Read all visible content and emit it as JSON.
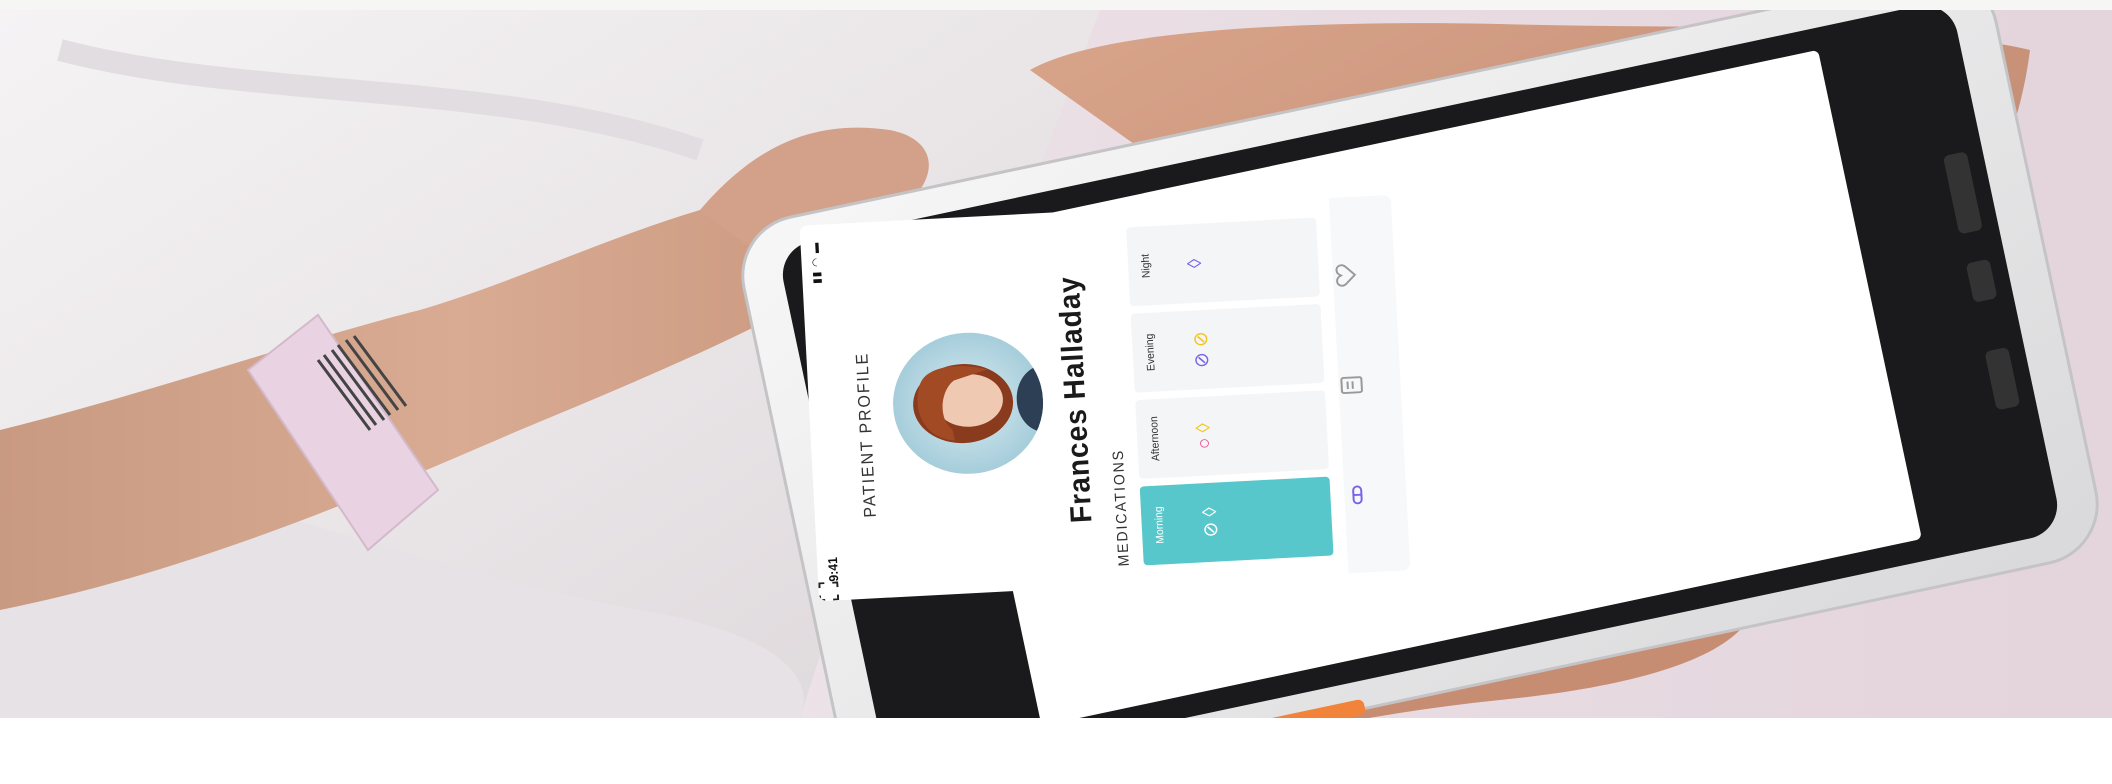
{
  "app": {
    "status_time": "9:41",
    "title": "PATIENT PROFILE",
    "patient_name": "Frances Halladay",
    "meds_label": "MEDICATIONS",
    "slots": [
      {
        "label": "Morning",
        "active": true
      },
      {
        "label": "Afternoon",
        "active": false
      },
      {
        "label": "Evening",
        "active": false
      },
      {
        "label": "Night",
        "active": false
      }
    ]
  },
  "colors": {
    "accent": "#57c7cb",
    "pill_purple": "#7b62e8",
    "pill_yellow": "#f3c51c",
    "pill_pink": "#e84b8a"
  },
  "icons": [
    "scan-icon",
    "pill-icon",
    "document-icon",
    "heart-icon",
    "back-icon",
    "home-icon",
    "menu-icon"
  ]
}
